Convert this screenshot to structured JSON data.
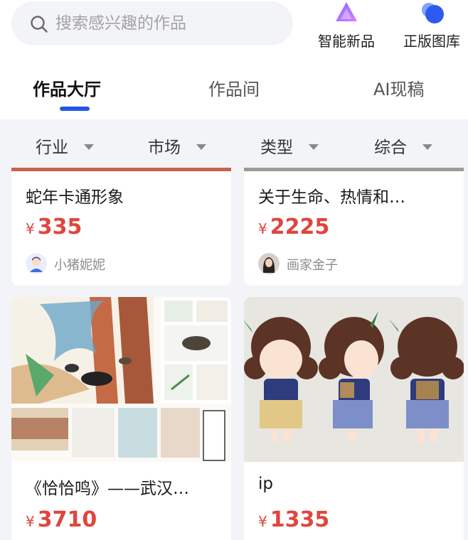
{
  "search": {
    "placeholder": "搜索感兴趣的作品"
  },
  "quick_links": [
    {
      "label": "智能新品",
      "icon": "triangle-gradient-icon"
    },
    {
      "label": "正版图库",
      "icon": "circles-icon"
    }
  ],
  "tabs": [
    {
      "label": "作品大厅",
      "active": true
    },
    {
      "label": "作品间",
      "active": false
    },
    {
      "label": "AI现稿",
      "active": false
    }
  ],
  "filters": [
    {
      "label": "行业"
    },
    {
      "label": "市场"
    },
    {
      "label": "类型"
    },
    {
      "label": "综合"
    }
  ],
  "currency": "¥",
  "works": [
    {
      "title": "蛇年卡通形象",
      "price": "335",
      "author": "小猪妮妮"
    },
    {
      "title": "关于生命、热情和…",
      "price": "2225",
      "author": "画家金子"
    },
    {
      "title": "《恰恰鸣》——武汉…",
      "price": "3710"
    },
    {
      "title": "ip",
      "price": "1335"
    }
  ],
  "colors": {
    "accent": "#2455e6",
    "price": "#e0453d"
  }
}
